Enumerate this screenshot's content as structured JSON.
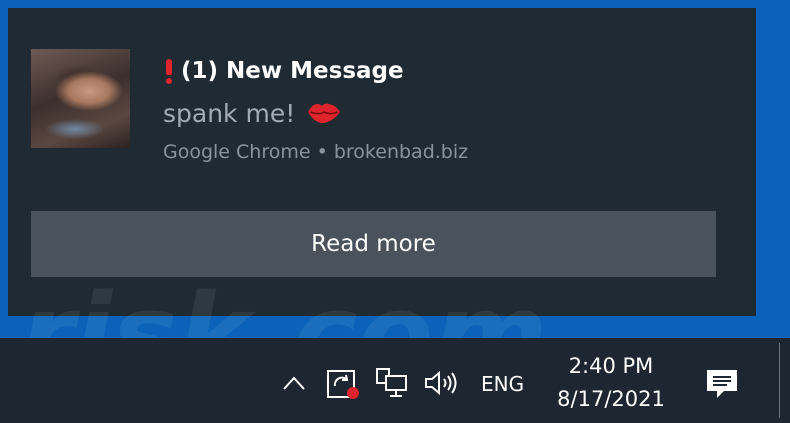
{
  "notification": {
    "title": "(1) New Message",
    "body": "spank me!",
    "attribution": "Google Chrome • brokenbad.biz",
    "action_button": "Read more",
    "title_icon": "red-exclamation-icon",
    "body_icon": "kiss-lips-icon"
  },
  "taskbar": {
    "language": "ENG",
    "time": "2:40 PM",
    "date": "8/17/2021",
    "tray_icons": [
      "chevron-up-icon",
      "sync-icon",
      "network-icon",
      "volume-icon",
      "action-center-icon"
    ]
  },
  "watermark": "risk.com",
  "colors": {
    "desktop": "#0a63b8",
    "toast_bg": "#202a33",
    "button_bg": "#4a535c",
    "taskbar_bg": "#1e2631",
    "accent_red": "#e0242b"
  }
}
